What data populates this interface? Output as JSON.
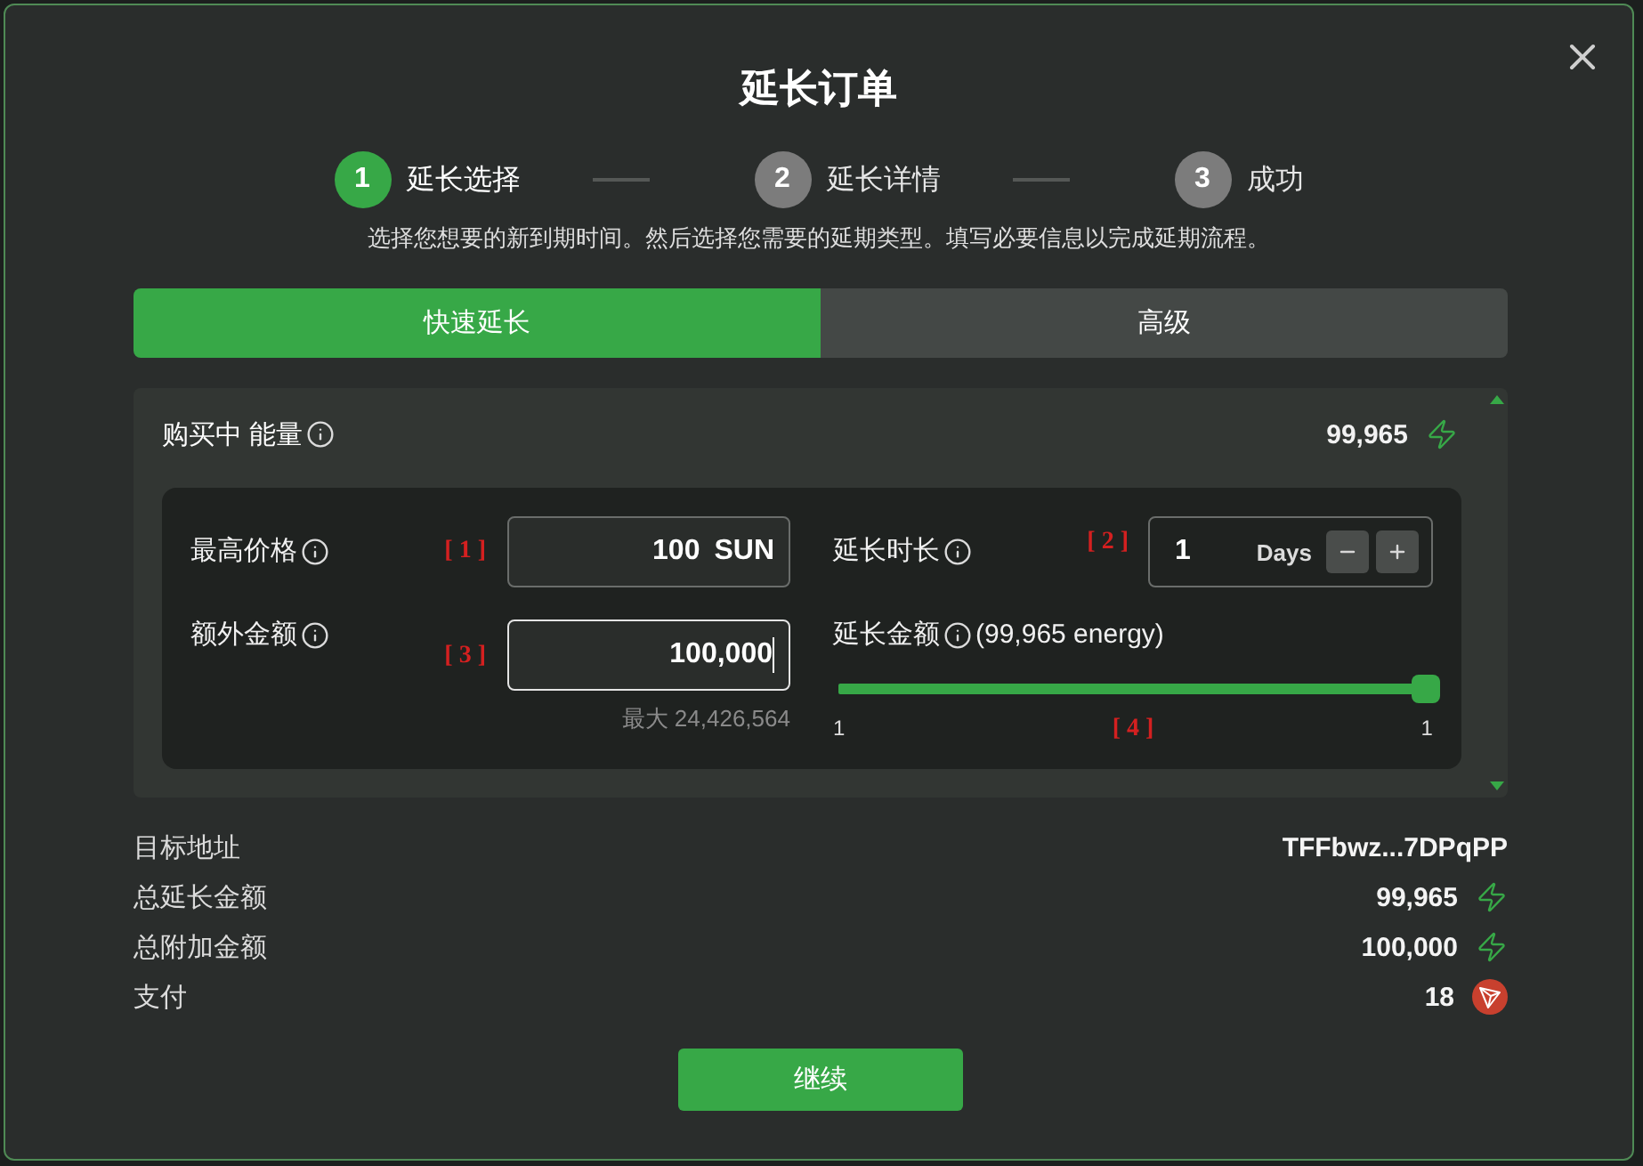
{
  "dialog": {
    "title": "延长订单"
  },
  "steps": [
    {
      "number": "1",
      "label": "延长选择",
      "active": true
    },
    {
      "number": "2",
      "label": "延长详情",
      "active": false
    },
    {
      "number": "3",
      "label": "成功",
      "active": false
    }
  ],
  "subtitle": "选择您想要的新到期时间。然后选择您需要的延期类型。填写必要信息以完成延期流程。",
  "tabs": [
    {
      "label": "快速延长",
      "selected": true
    },
    {
      "label": "高级",
      "selected": false
    }
  ],
  "resource_panel": {
    "title": "购买中 能量",
    "amount": "99,965",
    "max_price": {
      "label": "最高价格",
      "marker": "[ 1 ]",
      "value": "100",
      "unit": "SUN"
    },
    "duration": {
      "label": "延长时长",
      "marker": "[ 2 ]",
      "value": "1",
      "unit": "Days"
    },
    "extra_amount": {
      "label": "额外金额",
      "marker": "[ 3 ]",
      "value": "100,000",
      "focused": true,
      "hint": "最大 24,426,564"
    },
    "extend_amount": {
      "label": "延长金额",
      "note": "(99,965 energy)",
      "marker": "[ 4 ]",
      "level": 1,
      "min_label": "1",
      "max_label": "1"
    }
  },
  "summary": [
    {
      "label": "目标地址",
      "value": "TFFbwz...7DPqPP",
      "kind": "address"
    },
    {
      "label": "总延长金额",
      "value": "99,965",
      "kind": "energy"
    },
    {
      "label": "总附加金额",
      "value": "100,000",
      "kind": "energy"
    },
    {
      "label": "支付",
      "value": "18",
      "kind": "trx"
    }
  ],
  "continue_button": {
    "label": "继续"
  }
}
